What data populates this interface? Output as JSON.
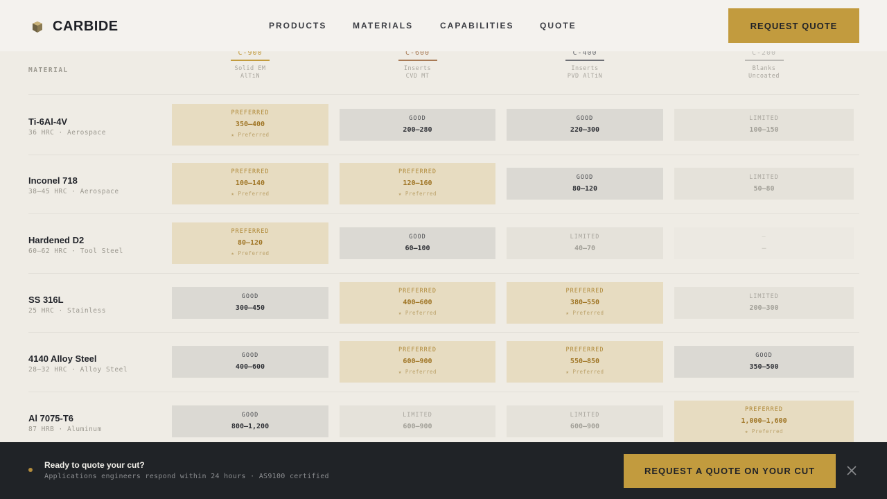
{
  "brand": {
    "name": "CARBIDE"
  },
  "nav": {
    "items": [
      {
        "label": "PRODUCTS"
      },
      {
        "label": "MATERIALS"
      },
      {
        "label": "CAPABILITIES"
      },
      {
        "label": "QUOTE"
      }
    ],
    "cta_label": "REQUEST QUOTE"
  },
  "table": {
    "material_header": "MATERIAL",
    "columns": [
      {
        "code": "C-900",
        "line1": "Solid EM",
        "line2": "AlTiN",
        "color": "#c29b3e"
      },
      {
        "code": "C-600",
        "line1": "Inserts",
        "line2": "CVD MT",
        "color": "#a87a55"
      },
      {
        "code": "C-400",
        "line1": "Inserts",
        "line2": "PVD AlTiN",
        "color": "#6e7075"
      },
      {
        "code": "C-200",
        "line1": "Blanks",
        "line2": "Uncoated",
        "color": "#bcbab5"
      }
    ],
    "rows": [
      {
        "name": "Ti-6Al-4V",
        "meta": "36 HRC · Aerospace",
        "cells": [
          {
            "label": "PREFERRED",
            "value": "350–400",
            "note": "★ Preferred"
          },
          {
            "label": "GOOD",
            "value": "200–280"
          },
          {
            "label": "GOOD",
            "value": "220–300"
          },
          {
            "label": "LIMITED",
            "value": "100–150"
          }
        ]
      },
      {
        "name": "Inconel 718",
        "meta": "38–45 HRC · Aerospace",
        "cells": [
          {
            "label": "PREFERRED",
            "value": "100–140",
            "note": "★ Preferred"
          },
          {
            "label": "PREFERRED",
            "value": "120–160",
            "note": "★ Preferred"
          },
          {
            "label": "GOOD",
            "value": "80–120"
          },
          {
            "label": "LIMITED",
            "value": "50–80"
          }
        ]
      },
      {
        "name": "Hardened D2",
        "meta": "60–62 HRC · Tool Steel",
        "cells": [
          {
            "label": "PREFERRED",
            "value": "80–120",
            "note": "★ Preferred"
          },
          {
            "label": "GOOD",
            "value": "60–100"
          },
          {
            "label": "LIMITED",
            "value": "40–70"
          },
          {
            "label": "—",
            "value": "—"
          }
        ]
      },
      {
        "name": "SS 316L",
        "meta": "25 HRC · Stainless",
        "cells": [
          {
            "label": "GOOD",
            "value": "300–450"
          },
          {
            "label": "PREFERRED",
            "value": "400–600",
            "note": "★ Preferred"
          },
          {
            "label": "PREFERRED",
            "value": "380–550",
            "note": "★ Preferred"
          },
          {
            "label": "LIMITED",
            "value": "200–300"
          }
        ]
      },
      {
        "name": "4140 Alloy Steel",
        "meta": "28–32 HRC · Alloy Steel",
        "cells": [
          {
            "label": "GOOD",
            "value": "400–600"
          },
          {
            "label": "PREFERRED",
            "value": "600–900",
            "note": "★ Preferred"
          },
          {
            "label": "PREFERRED",
            "value": "550–850",
            "note": "★ Preferred"
          },
          {
            "label": "GOOD",
            "value": "350–500"
          }
        ]
      },
      {
        "name": "Al 7075-T6",
        "meta": "87 HRB · Aluminum",
        "cells": [
          {
            "label": "GOOD",
            "value": "800–1,200"
          },
          {
            "label": "LIMITED",
            "value": "600–900"
          },
          {
            "label": "LIMITED",
            "value": "600–900"
          },
          {
            "label": "PREFERRED",
            "value": "1,000–1,600",
            "note": "★ Preferred"
          }
        ]
      }
    ]
  },
  "footer": {
    "title": "Ready to quote your cut?",
    "subtitle": "Applications engineers respond within 24 hours · AS9100 certified",
    "cta_label": "REQUEST A QUOTE ON YOUR CUT",
    "close_icon": "close-icon"
  }
}
